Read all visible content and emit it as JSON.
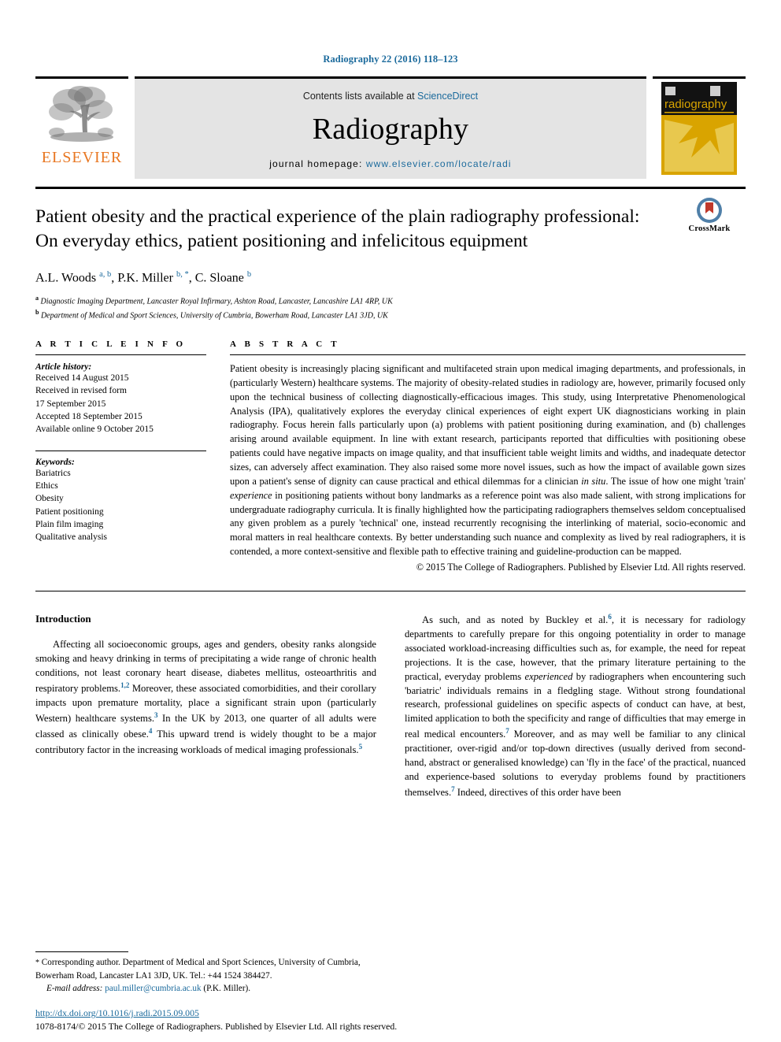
{
  "running_head": "Radiography 22 (2016) 118–123",
  "masthead": {
    "publisher_name": "ELSEVIER",
    "contents_prefix": "Contents lists available at ",
    "contents_link": "ScienceDirect",
    "journal_name": "Radiography",
    "homepage_prefix": "journal homepage: ",
    "homepage_url": "www.elsevier.com/locate/radi",
    "cover_title": "radiography"
  },
  "article": {
    "title": "Patient obesity and the practical experience of the plain radiography professional: On everyday ethics, patient positioning and infelicitous equipment",
    "crossmark_label": "CrossMark",
    "authors_html": "A.L. Woods <sup>a, b</sup>, P.K. Miller <sup>b, *</sup>, C. Sloane <sup>b</sup>",
    "affiliations": [
      {
        "marker": "a",
        "text": "Diagnostic Imaging Department, Lancaster Royal Infirmary, Ashton Road, Lancaster, Lancashire LA1 4RP, UK"
      },
      {
        "marker": "b",
        "text": "Department of Medical and Sport Sciences, University of Cumbria, Bowerham Road, Lancaster LA1 3JD, UK"
      }
    ]
  },
  "info": {
    "heading": "A R T I C L E   I N F O",
    "history_title": "Article history:",
    "history": [
      "Received 14 August 2015",
      "Received in revised form",
      "17 September 2015",
      "Accepted 18 September 2015",
      "Available online 9 October 2015"
    ],
    "keywords_title": "Keywords:",
    "keywords": [
      "Bariatrics",
      "Ethics",
      "Obesity",
      "Patient positioning",
      "Plain film imaging",
      "Qualitative analysis"
    ]
  },
  "abstract": {
    "heading": "A B S T R A C T",
    "body_html": "Patient obesity is increasingly placing significant and multifaceted strain upon medical imaging departments, and professionals, in (particularly Western) healthcare systems. The majority of obesity-related studies in radiology are, however, primarily focused only upon the technical business of collecting diagnostically-efficacious images. This study, using Interpretative Phenomenological Analysis (IPA), qualitatively explores the everyday clinical experiences of eight expert UK diagnosticians working in plain radiography. Focus herein falls particularly upon (a) problems with patient positioning during examination, and (b) challenges arising around available equipment. In line with extant research, participants reported that difficulties with positioning obese patients could have negative impacts on image quality, and that insufficient table weight limits and widths, and inadequate detector sizes, can adversely affect examination. They also raised some more novel issues, such as how the impact of available gown sizes upon a patient's sense of dignity can cause practical and ethical dilemmas for a clinician <em>in situ</em>. The issue of how one might 'train' <em>experience</em> in positioning patients without bony landmarks as a reference point was also made salient, with strong implications for undergraduate radiography curricula. It is finally highlighted how the participating radiographers themselves seldom conceptualised any given problem as a purely 'technical' one, instead recurrently recognising the interlinking of material, socio-economic and moral matters in real healthcare contexts. By better understanding such nuance and complexity as lived by real radiographers, it is contended, a more context-sensitive and flexible path to effective training and guideline-production can be mapped.",
    "copyright": "© 2015 The College of Radiographers. Published by Elsevier Ltd. All rights reserved."
  },
  "body": {
    "intro_heading": "Introduction",
    "left_html": "Affecting all socioeconomic groups, ages and genders, obesity ranks alongside smoking and heavy drinking in terms of precipitating a wide range of chronic health conditions, not least coronary heart disease, diabetes mellitus, osteoarthritis and respiratory problems.<sup>1,2</sup> Moreover, these associated comorbidities, and their corollary impacts upon premature mortality, place a significant strain upon (particularly Western) healthcare systems.<sup>3</sup> In the UK by 2013, one quarter of all adults were classed as clinically obese.<sup>4</sup> This upward trend is widely thought to be a major contributory factor in the increasing workloads of medical imaging professionals.<sup>5</sup>",
    "right_html": "As such, and as noted by Buckley et al.<sup>6</sup>, it is necessary for radiology departments to carefully prepare for this ongoing potentiality in order to manage associated workload-increasing difficulties such as, for example, the need for repeat projections. It is the case, however, that the primary literature pertaining to the practical, everyday problems <em>experienced</em> by radiographers when encountering such 'bariatric' individuals remains in a fledgling stage. Without strong foundational research, professional guidelines on specific aspects of conduct can have, at best, limited application to both the specificity and range of difficulties that may emerge in real medical encounters.<sup>7</sup> Moreover, and as may well be familiar to any clinical practitioner, over-rigid and/or top-down directives (usually derived from second-hand, abstract or generalised knowledge) can 'fly in the face' of the practical, nuanced and experience-based solutions to everyday problems found by practitioners themselves.<sup>7</sup> Indeed, directives of this order have been"
  },
  "footnotes": {
    "corresponding_html": "<span class=\"star\">*</span> Corresponding author. Department of Medical and Sport Sciences, University of Cumbria, Bowerham Road, Lancaster LA1 3JD, UK. Tel.: +44 1524 384427.",
    "email_label": "E-mail address:",
    "email": "paul.miller@cumbria.ac.uk",
    "email_owner": "(P.K. Miller)."
  },
  "footer": {
    "doi": "http://dx.doi.org/10.1016/j.radi.2015.09.005",
    "issn_line": "1078-8174/© 2015 The College of Radiographers. Published by Elsevier Ltd. All rights reserved."
  },
  "colors": {
    "link": "#1b6a9c",
    "elsevier_orange": "#e87722",
    "cover_gold": "#d9a400",
    "masthead_bg": "#e4e4e4"
  }
}
